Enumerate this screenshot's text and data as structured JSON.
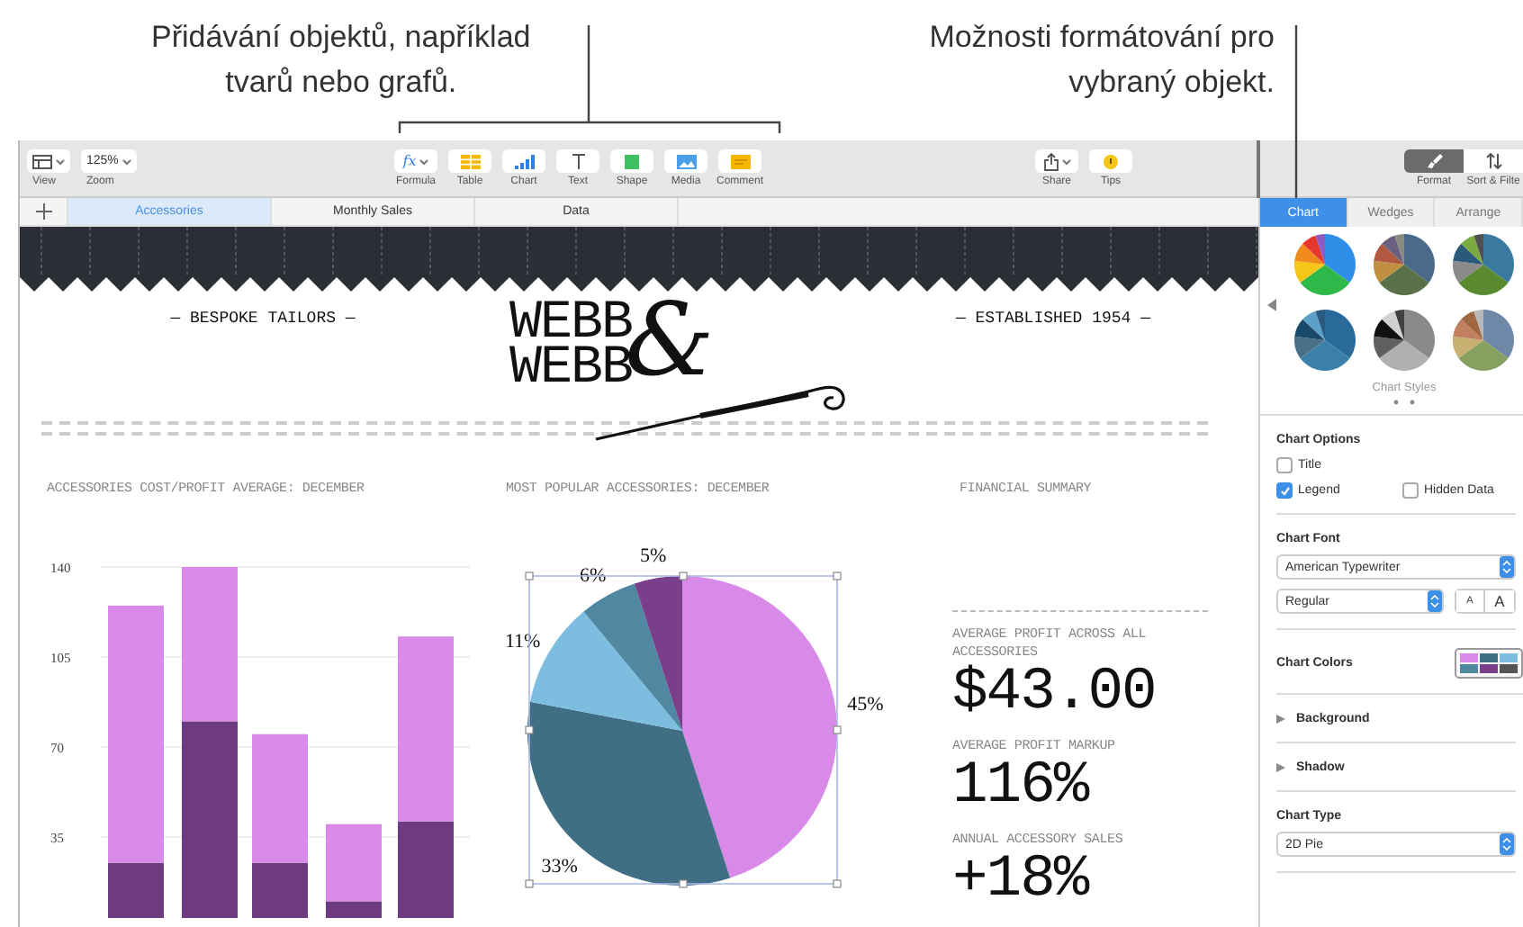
{
  "callouts": [
    {
      "lines": [
        "Přidávání objektů, například",
        "tvarů nebo grafů."
      ]
    },
    {
      "lines": [
        "Možnosti formátování pro",
        "vybraný objekt."
      ]
    }
  ],
  "toolbar": {
    "left": [
      {
        "kind": "view",
        "label": "View"
      },
      {
        "kind": "zoom",
        "label": "Zoom",
        "value": "125%"
      }
    ],
    "insert": [
      {
        "kind": "formula",
        "label": "Formula",
        "value": "fx"
      },
      {
        "kind": "table",
        "label": "Table"
      },
      {
        "kind": "chart",
        "label": "Chart"
      },
      {
        "kind": "text",
        "label": "Text"
      },
      {
        "kind": "shape",
        "label": "Shape"
      },
      {
        "kind": "media",
        "label": "Media"
      },
      {
        "kind": "comment",
        "label": "Comment"
      }
    ],
    "share": [
      {
        "kind": "share",
        "label": "Share"
      },
      {
        "kind": "tips",
        "label": "Tips"
      }
    ],
    "inspector": [
      {
        "kind": "format",
        "label": "Format",
        "selected": true
      },
      {
        "kind": "sort",
        "label": "Sort & Filte",
        "selected": false
      }
    ]
  },
  "sheet_tabs": [
    {
      "label": "Accessories",
      "selected": true
    },
    {
      "label": "Monthly Sales",
      "selected": false
    },
    {
      "label": "Data",
      "selected": false
    }
  ],
  "document": {
    "header": {
      "left": "— BESPOKE TAILORS —",
      "logo_lines": [
        "WEBB",
        "WEBB"
      ],
      "ampersand": "&",
      "right": "— ESTABLISHED 1954 —"
    },
    "bar_chart": {
      "title": "ACCESSORIES COST/PROFIT AVERAGE: DECEMBER",
      "chart_data": {
        "type": "bar",
        "stacked": true,
        "grid": true,
        "ylim": [
          0,
          140
        ],
        "yticks": [
          35,
          70,
          105,
          140
        ],
        "series": [
          {
            "color": "#6e3a80",
            "values": [
              25,
              80,
              25,
              10,
              41
            ]
          },
          {
            "color": "#d98ae8",
            "values": [
              100,
              60,
              50,
              30,
              72
            ]
          }
        ]
      }
    },
    "pie_chart": {
      "title": "MOST POPULAR ACCESSORIES: DECEMBER",
      "selected": true,
      "chart_data": {
        "type": "pie",
        "values": [
          45,
          33,
          11,
          6,
          5
        ],
        "colors": [
          "#d98ae8",
          "#3f6e85",
          "#7cbde0",
          "#4f88a0",
          "#7a3f8a"
        ],
        "value_labels": [
          "45%",
          "33%",
          "11%",
          "6%",
          "5%"
        ]
      }
    },
    "summary": {
      "title": "FINANCIAL SUMMARY",
      "metrics": [
        {
          "label": "AVERAGE PROFIT ACROSS ALL ACCESSORIES",
          "value": "$43.00"
        },
        {
          "label": "AVERAGE PROFIT MARKUP",
          "value": "116%"
        },
        {
          "label": "ANNUAL ACCESSORY SALES",
          "value": "+18%"
        }
      ]
    }
  },
  "sidebar": {
    "tabs": [
      {
        "label": "Chart",
        "selected": true
      },
      {
        "label": "Wedges",
        "selected": false
      },
      {
        "label": "Arrange",
        "selected": false
      }
    ],
    "styles_label": "Chart Styles",
    "options": {
      "title": "Chart Options",
      "checkboxes": [
        {
          "label": "Title",
          "checked": false
        },
        {
          "label": "Legend",
          "checked": true
        },
        {
          "label": "Hidden Data",
          "checked": false
        }
      ]
    },
    "font": {
      "title": "Chart Font",
      "family": "American Typewriter",
      "style": "Regular",
      "size_buttons": [
        "A",
        "A"
      ]
    },
    "colors": {
      "title": "Chart Colors"
    },
    "sections": [
      {
        "label": "Background",
        "expanded": false
      },
      {
        "label": "Shadow",
        "expanded": false
      }
    ],
    "chart_type": {
      "title": "Chart Type",
      "value": "2D Pie"
    }
  }
}
